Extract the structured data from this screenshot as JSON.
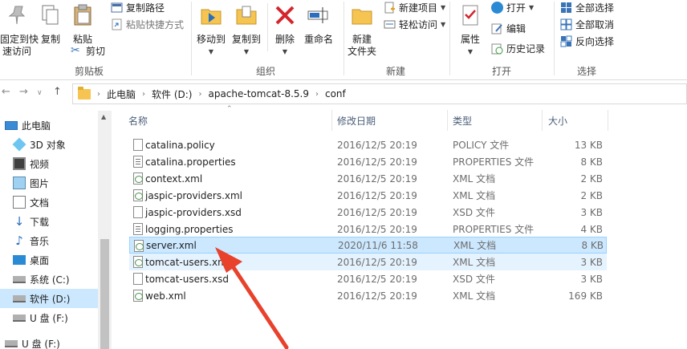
{
  "ribbon": {
    "clipboard": {
      "pin_label_1": "固定到快",
      "pin_label_2": "速访问",
      "copy": "复制",
      "paste": "粘贴",
      "copy_path": "复制路径",
      "paste_shortcut": "粘贴快捷方式",
      "cut": "剪切",
      "group": "剪贴板"
    },
    "organize": {
      "move_to": "移动到",
      "copy_to": "复制到",
      "delete": "删除",
      "rename": "重命名",
      "group": "组织"
    },
    "new": {
      "new_folder_1": "新建",
      "new_folder_2": "文件夹",
      "new_item": "新建项目",
      "easy_access": "轻松访问",
      "group": "新建"
    },
    "open": {
      "properties": "属性",
      "open": "打开",
      "edit": "编辑",
      "history": "历史记录",
      "group": "打开"
    },
    "select": {
      "select_all": "全部选择",
      "select_none": "全部取消",
      "invert": "反向选择",
      "group": "选择"
    }
  },
  "address": {
    "crumbs": [
      "此电脑",
      "软件 (D:)",
      "apache-tomcat-8.5.9",
      "conf"
    ]
  },
  "nav_pane": {
    "items": [
      {
        "label": "此电脑",
        "icon": "pc-icon"
      },
      {
        "label": "3D 对象",
        "icon": "3d-objects-icon"
      },
      {
        "label": "视频",
        "icon": "video-icon"
      },
      {
        "label": "图片",
        "icon": "pictures-icon"
      },
      {
        "label": "文档",
        "icon": "documents-icon"
      },
      {
        "label": "下载",
        "icon": "download-icon"
      },
      {
        "label": "音乐",
        "icon": "music-icon"
      },
      {
        "label": "桌面",
        "icon": "desktop-icon"
      },
      {
        "label": "系统 (C:)",
        "icon": "drive-c-icon"
      },
      {
        "label": "软件 (D:)",
        "icon": "drive-d-icon"
      },
      {
        "label": "U 盘 (F:)",
        "icon": "usb-drive-icon"
      },
      {
        "label": "U 盘 (F:)",
        "icon": "usb-drive-icon"
      }
    ]
  },
  "list": {
    "headers": {
      "name": "名称",
      "date": "修改日期",
      "type": "类型",
      "size": "大小"
    },
    "files": [
      {
        "name": "catalina.policy",
        "date": "2016/12/5 20:19",
        "type": "POLICY 文件",
        "size": "13 KB",
        "icon": "file-icon"
      },
      {
        "name": "catalina.properties",
        "date": "2016/12/5 20:19",
        "type": "PROPERTIES 文件",
        "size": "8 KB",
        "icon": "properties-file-icon"
      },
      {
        "name": "context.xml",
        "date": "2016/12/5 20:19",
        "type": "XML 文档",
        "size": "2 KB",
        "icon": "xml-file-icon"
      },
      {
        "name": "jaspic-providers.xml",
        "date": "2016/12/5 20:19",
        "type": "XML 文档",
        "size": "2 KB",
        "icon": "xml-file-icon"
      },
      {
        "name": "jaspic-providers.xsd",
        "date": "2016/12/5 20:19",
        "type": "XSD 文件",
        "size": "3 KB",
        "icon": "file-icon"
      },
      {
        "name": "logging.properties",
        "date": "2016/12/5 20:19",
        "type": "PROPERTIES 文件",
        "size": "4 KB",
        "icon": "properties-file-icon"
      },
      {
        "name": "server.xml",
        "date": "2020/11/6 11:58",
        "type": "XML 文档",
        "size": "8 KB",
        "icon": "xml-file-icon"
      },
      {
        "name": "tomcat-users.xml",
        "date": "2016/12/5 20:19",
        "type": "XML 文档",
        "size": "3 KB",
        "icon": "xml-file-icon"
      },
      {
        "name": "tomcat-users.xsd",
        "date": "2016/12/5 20:19",
        "type": "XSD 文件",
        "size": "3 KB",
        "icon": "file-icon"
      },
      {
        "name": "web.xml",
        "date": "2016/12/5 20:19",
        "type": "XML 文档",
        "size": "169 KB",
        "icon": "xml-file-icon"
      }
    ]
  },
  "colors": {
    "selection": "#cce8ff",
    "hover": "#e5f3ff",
    "annotation_arrow": "#e8412c"
  }
}
